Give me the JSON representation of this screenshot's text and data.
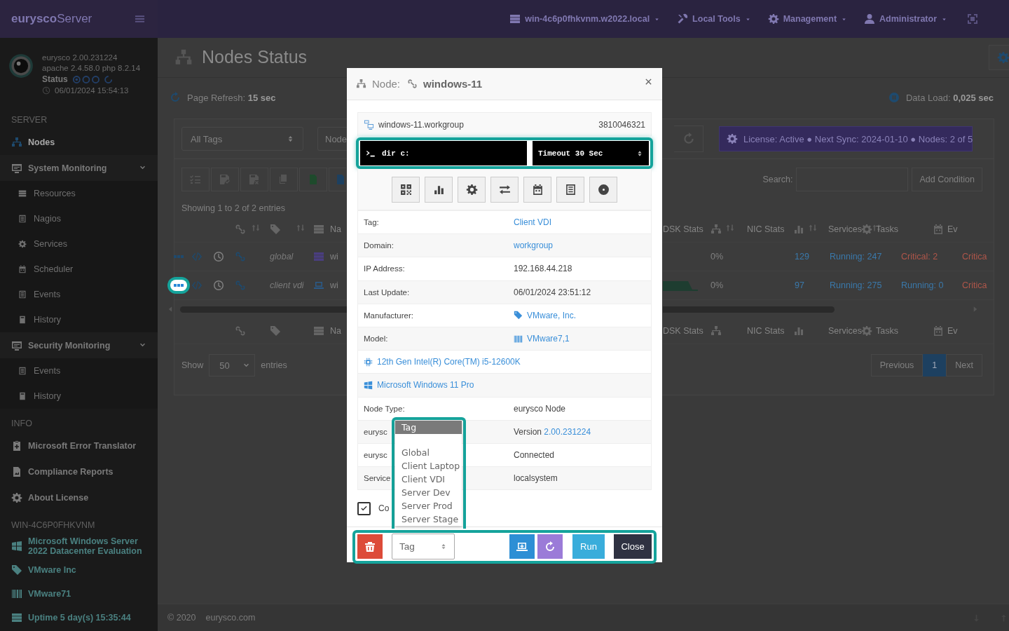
{
  "topbar": {
    "brand_bold": "eurysco",
    "brand_rest": "Server",
    "menus": [
      {
        "label": "win-4c6p0fhkvnm.w2022.local"
      },
      {
        "label": "Local Tools"
      },
      {
        "label": "Management"
      },
      {
        "label": "Administrator"
      }
    ]
  },
  "sidebar": {
    "info_lines": [
      "eurysco 2.00.231224",
      "apache 2.4.58.0  php 8.2.14"
    ],
    "status_label": "Status",
    "timestamp": "06/01/2024 15:54:13",
    "sections": [
      {
        "heading": "SERVER",
        "items": [
          {
            "label": "Nodes",
            "selected": true
          },
          {
            "label": "System Monitoring",
            "selected": false,
            "expanded": true,
            "children": [
              {
                "label": "Resources",
                "selected": false
              },
              {
                "label": "Nagios",
                "selected": false
              },
              {
                "label": "Services",
                "selected": false
              },
              {
                "label": "Scheduler",
                "selected": false
              },
              {
                "label": "Events",
                "selected": false
              },
              {
                "label": "History",
                "selected": false
              }
            ]
          },
          {
            "label": "Security Monitoring",
            "selected": false,
            "expanded": true,
            "children": [
              {
                "label": "Events",
                "selected": false
              },
              {
                "label": "History",
                "selected": false
              }
            ]
          }
        ]
      },
      {
        "heading": "INFO",
        "items": [
          {
            "label": "Microsoft Error Translator",
            "selected": false
          },
          {
            "label": "Compliance Reports",
            "selected": false
          },
          {
            "label": "About License",
            "selected": false
          }
        ]
      },
      {
        "heading": "WIN-4C6P0FHKVNM",
        "items": [
          {
            "label": "Microsoft  Windows  Server 2022  Datacenter  Evaluation",
            "selected": false
          },
          {
            "label": "VMware Inc",
            "selected": false
          },
          {
            "label": "VMware71",
            "selected": false
          },
          {
            "label": "Uptime 5 day(s) 15:35:44",
            "selected": false
          }
        ]
      }
    ]
  },
  "page": {
    "title": "Nodes Status",
    "refresh_label": "Page Refresh:",
    "refresh_value": "15 sec",
    "load_label": "Data Load:",
    "load_value": "0,025 sec"
  },
  "filters": {
    "tag_select": "All Tags",
    "node_select": "Node",
    "license": "License: Active ● Next Sync: 2024-01-10 ● Nodes: 2 of 5"
  },
  "table": {
    "info": "Showing 1 to 2 of 2 entries",
    "search_label": "Search:",
    "add_condition": "Add Condition",
    "header": {
      "name": "Na",
      "columns": [
        "DSK Stats",
        "NIC Stats",
        "Services",
        "Tasks",
        "Ev"
      ]
    },
    "rows": [
      {
        "highlighted": false,
        "tag": "global",
        "kind": "server",
        "name": "wi",
        "sparkline": false,
        "disk": "0%",
        "nic": "129",
        "services": {
          "text": "Running: 247",
          "kind": "ok"
        },
        "tasks": {
          "text": "Critical: 2",
          "kind": "critical"
        },
        "events": {
          "text": "Critica",
          "kind": "critical"
        }
      },
      {
        "highlighted": true,
        "tag": "client vdi",
        "kind": "laptop",
        "name": "wi",
        "sparkline": true,
        "disk": "0%",
        "nic": "97",
        "services": {
          "text": "Running: 275",
          "kind": "ok"
        },
        "tasks": {
          "text": "Running: 0",
          "kind": "ok"
        },
        "events": {
          "text": "Critica",
          "kind": "critical"
        }
      }
    ],
    "footer": {
      "name": "Na",
      "columns": [
        "DSK Stats",
        "NIC Stats",
        "Services",
        "Tasks",
        "Ev"
      ]
    },
    "show_label": "Show",
    "page_size": "50",
    "entries_label": "entries",
    "pagination": [
      {
        "label": "Previous",
        "selected": false
      },
      {
        "label": "1",
        "selected": true
      },
      {
        "label": "Next",
        "selected": false
      }
    ]
  },
  "footer": {
    "copyright": "© 2020",
    "site": "eurysco.com"
  },
  "modal": {
    "title_label": "Node:",
    "title_value": "windows-11",
    "host": "windows-11.workgroup",
    "serial": "3810046321",
    "command": "dir c:",
    "timeout": "Timeout 30 Sec",
    "rows": [
      {
        "label": "Tag:",
        "value": "Client VDI",
        "kind": "link"
      },
      {
        "label": "Domain:",
        "value": "workgroup",
        "kind": "link"
      },
      {
        "label": "IP Address:",
        "value": "192.168.44.218",
        "kind": "text"
      },
      {
        "label": "Last Update:",
        "value": "06/01/2024 23:51:12",
        "kind": "text"
      },
      {
        "label": "Manufacturer:",
        "value": "VMware, Inc.",
        "kind": "tag-link"
      },
      {
        "label": "Model:",
        "value": "VMware7,1",
        "kind": "barcode-link"
      },
      {
        "value": "12th Gen Intel(R) Core(TM) i5-12600K",
        "kind": "cpu-link"
      },
      {
        "value": "Microsoft Windows 11 Pro",
        "kind": "windows-link"
      },
      {
        "label": "Node Type:",
        "value": "eurysco Node",
        "kind": "text"
      },
      {
        "label": "eurysc",
        "prefix": "Version",
        "value": "2.00.231224",
        "kind": "version"
      },
      {
        "label": "eurysc",
        "value": "Connected",
        "kind": "text"
      },
      {
        "label": "Service",
        "value": "localsystem",
        "kind": "text"
      }
    ],
    "confirm": {
      "label": "Co",
      "checked": true
    },
    "tag_select": {
      "value": "Tag",
      "options": [
        {
          "label": "Tag",
          "selected": true
        },
        {
          "label": "Global",
          "selected": false
        },
        {
          "label": "Client Laptop",
          "selected": false
        },
        {
          "label": "Client VDI",
          "selected": false
        },
        {
          "label": "Server Dev",
          "selected": false
        },
        {
          "label": "Server Prod",
          "selected": false
        },
        {
          "label": "Server Stage",
          "selected": false
        }
      ]
    },
    "run": "Run",
    "close": "Close"
  }
}
